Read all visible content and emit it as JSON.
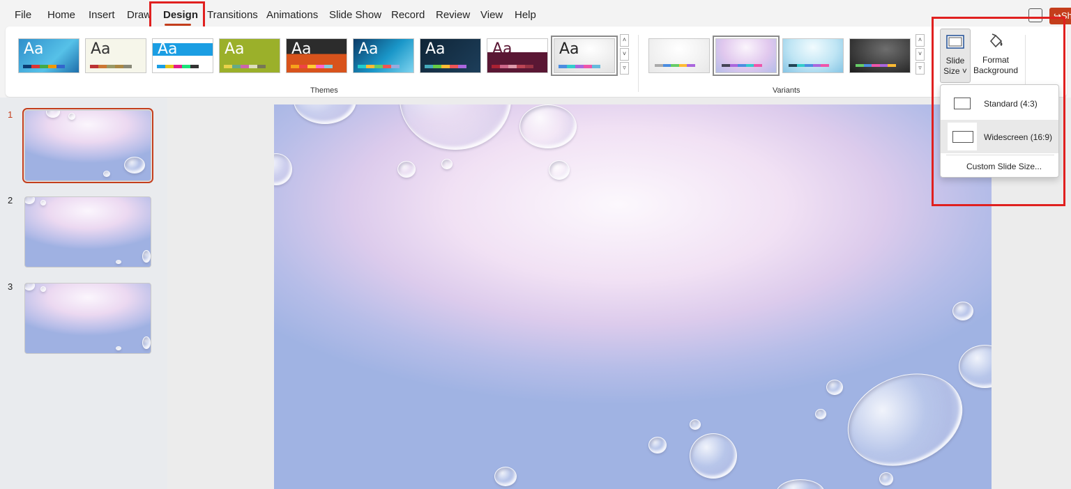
{
  "menu": {
    "tabs": [
      "File",
      "Home",
      "Insert",
      "Draw",
      "Design",
      "Transitions",
      "Animations",
      "Slide Show",
      "Record",
      "Review",
      "View",
      "Help"
    ],
    "active_tab": "Design",
    "share_label": "Sh"
  },
  "ribbon": {
    "themes_label": "Themes",
    "variants_label": "Variants",
    "theme_text": "Aa",
    "slide_size": {
      "line1": "Slide",
      "line2": "Size ˅"
    },
    "format_background": {
      "line1": "Format",
      "line2": "Background"
    }
  },
  "dropdown": {
    "items": [
      "Standard (4:3)",
      "Widescreen (16:9)"
    ],
    "custom_label": "Custom Slide Size..."
  },
  "slides": {
    "numbers": [
      "1",
      "2",
      "3"
    ],
    "selected": "1"
  },
  "colors": {
    "accent": "#c43e1c",
    "highlight_box": "#e0201f"
  }
}
